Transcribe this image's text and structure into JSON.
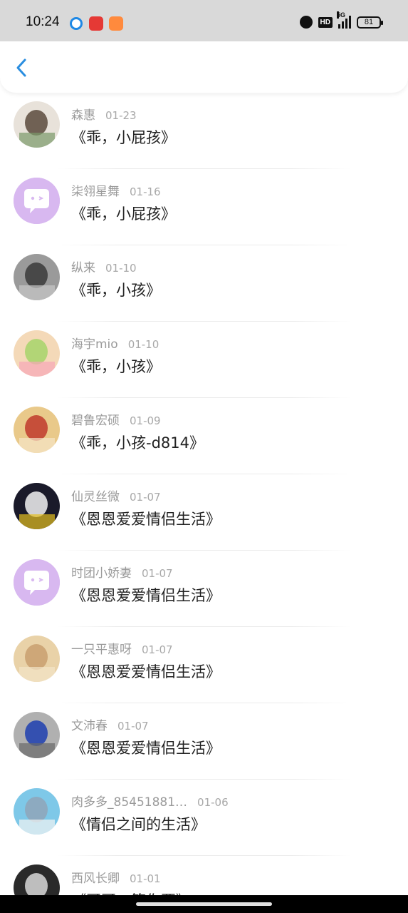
{
  "status_bar": {
    "time": "10:24",
    "battery": "81",
    "network": "5G",
    "hd_label": "HD"
  },
  "header": {
    "back_icon": "chevron-left-icon"
  },
  "colors": {
    "accent": "#2a8ee0",
    "default_avatar": "#d8b8f0"
  },
  "comments": [
    {
      "name": "森惠",
      "date": "01-23",
      "title": "《乖，小屁孩》",
      "avatar": "photo"
    },
    {
      "name": "柒翎星舞",
      "date": "01-16",
      "title": "《乖，小屁孩》",
      "avatar": "default"
    },
    {
      "name": "纵来",
      "date": "01-10",
      "title": "《乖，小孩》",
      "avatar": "photo"
    },
    {
      "name": "海宇mio",
      "date": "01-10",
      "title": "《乖，小孩》",
      "avatar": "photo"
    },
    {
      "name": "碧鲁宏硕",
      "date": "01-09",
      "title": "《乖，小孩-d814》",
      "avatar": "photo"
    },
    {
      "name": "仙灵丝微",
      "date": "01-07",
      "title": "《恩恩爱爱情侣生活》",
      "avatar": "photo"
    },
    {
      "name": "时团小娇妻",
      "date": "01-07",
      "title": "《恩恩爱爱情侣生活》",
      "avatar": "default"
    },
    {
      "name": "一只平惠呀",
      "date": "01-07",
      "title": "《恩恩爱爱情侣生活》",
      "avatar": "photo"
    },
    {
      "name": "文沛春",
      "date": "01-07",
      "title": "《恩恩爱爱情侣生活》",
      "avatar": "photo"
    },
    {
      "name": "肉多多_85451881…",
      "date": "01-06",
      "title": "《情侣之间的生活》",
      "avatar": "photo"
    },
    {
      "name": "西风长卿",
      "date": "01-01",
      "title": "《哥哥，等你要》",
      "avatar": "photo"
    }
  ]
}
